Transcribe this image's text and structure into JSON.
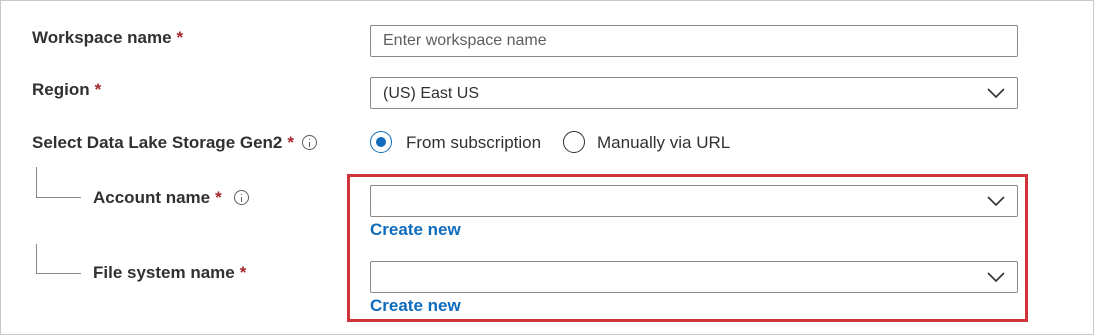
{
  "form": {
    "workspace": {
      "label": "Workspace name",
      "required": "*",
      "placeholder": "Enter workspace name",
      "value": ""
    },
    "region": {
      "label": "Region",
      "required": "*",
      "selected": "(US) East US"
    },
    "storage": {
      "label": "Select Data Lake Storage Gen2",
      "required": "*",
      "options": [
        {
          "label": "From subscription",
          "checked": true
        },
        {
          "label": "Manually via URL",
          "checked": false
        }
      ]
    },
    "account": {
      "label": "Account name",
      "required": "*",
      "selected": "",
      "create_link": "Create new"
    },
    "filesystem": {
      "label": "File system name",
      "required": "*",
      "selected": "",
      "create_link": "Create new"
    }
  },
  "colors": {
    "accent": "#0f6cbd",
    "required": "#a4262c",
    "highlight": "#d13438"
  }
}
